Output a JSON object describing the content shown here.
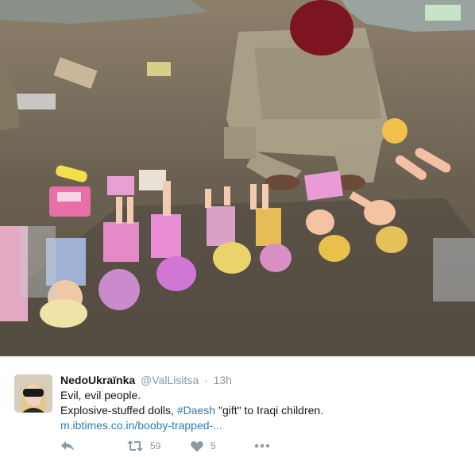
{
  "tweet": {
    "display_name": "NedoUkraïnka",
    "handle": "@ValLisitsa",
    "separator": "·",
    "timestamp": "13h",
    "text_line_1": "Evil, evil people.",
    "text_line_2_prefix": "Explosive-stuffed dolls, ",
    "hashtag": "#Daesh",
    "text_line_2_suffix": " \"gift\" to Iraqi children.",
    "link_text": "m.ibtimes.co.in/booby-trapped-..."
  },
  "actions": {
    "retweet_count": "59",
    "like_count": "5"
  },
  "icons": {
    "reply": "reply-icon",
    "retweet": "retweet-icon",
    "like": "heart-icon",
    "more": "more-dots-icon"
  },
  "colors": {
    "link": "#2b7bb9",
    "muted": "#8899a6",
    "text": "#14171a"
  }
}
